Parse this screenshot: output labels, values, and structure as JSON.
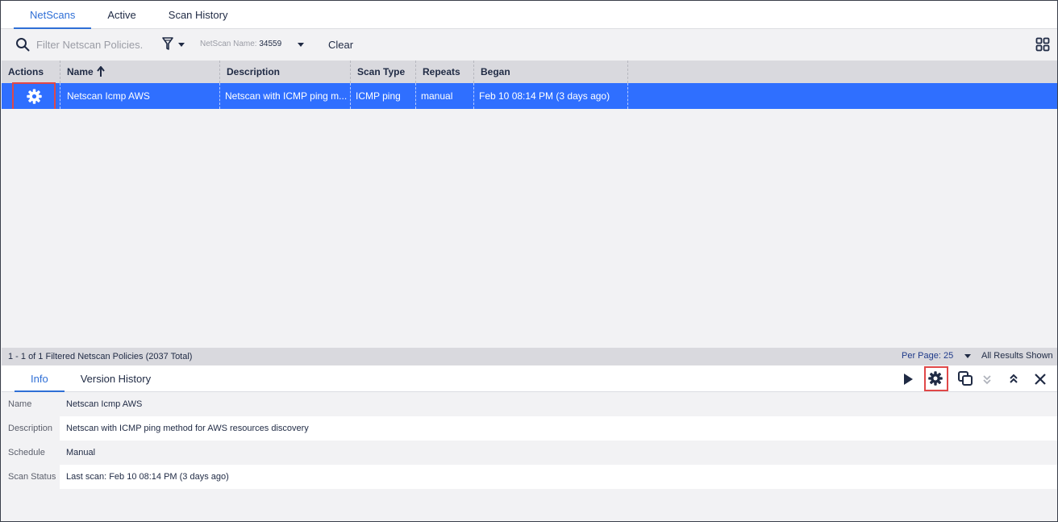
{
  "tabs": [
    {
      "label": "NetScans",
      "active": true
    },
    {
      "label": "Active"
    },
    {
      "label": "Scan History"
    }
  ],
  "toolbar": {
    "search_placeholder": "Filter Netscan Policies.",
    "filter_chip_label": "NetScan Name:",
    "filter_chip_value": "34559",
    "clear_label": "Clear",
    "icons": [
      "search-icon",
      "filter-icon",
      "grid-view-icon"
    ]
  },
  "table": {
    "columns": [
      "Actions",
      "Name",
      "Description",
      "Scan Type",
      "Repeats",
      "Began"
    ],
    "sort_column": "Name",
    "sort_direction": "ascending",
    "rows": [
      {
        "name": "Netscan Icmp AWS",
        "description": "Netscan with ICMP ping m...",
        "scan_type": "ICMP ping",
        "repeats": "manual",
        "began": "Feb 10 08:14 PM  (3 days ago)",
        "selected": true
      }
    ]
  },
  "status_bar": {
    "summary": "1 - 1 of 1 Filtered Netscan Policies (2037 Total)",
    "per_page": "Per Page: 25",
    "results": "All Results Shown"
  },
  "detail": {
    "tabs": [
      {
        "label": "Info",
        "active": true
      },
      {
        "label": "Version History"
      }
    ],
    "actions": [
      "play-icon",
      "settings-icon",
      "clone-icon",
      "chevron-double-down-icon",
      "chevron-double-up-icon",
      "close-icon"
    ],
    "fields": [
      {
        "label": "Name",
        "value": "Netscan Icmp AWS"
      },
      {
        "label": "Description",
        "value": "Netscan with ICMP ping method for AWS resources discovery"
      },
      {
        "label": "Schedule",
        "value": "Manual"
      },
      {
        "label": "Scan Status",
        "value": "Last scan: Feb 10 08:14 PM  (3 days ago)"
      }
    ]
  },
  "colors": {
    "accent": "#2f6fd6",
    "selected_row": "#2f6fff",
    "highlight_box": "#e04848",
    "text_dark": "#1f2a44"
  }
}
